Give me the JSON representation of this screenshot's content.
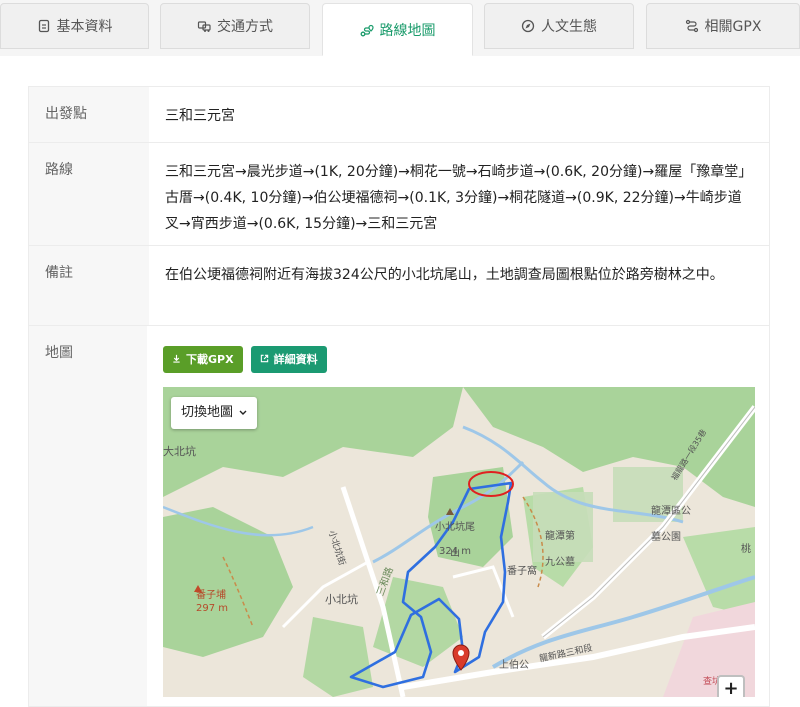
{
  "tabs": [
    {
      "label": "基本資料",
      "icon": "document-icon",
      "active": false
    },
    {
      "label": "交通方式",
      "icon": "car-icon",
      "active": false
    },
    {
      "label": "路線地圖",
      "icon": "route-icon",
      "active": true
    },
    {
      "label": "人文生態",
      "icon": "compass-icon",
      "active": false
    },
    {
      "label": "相關GPX",
      "icon": "path-icon",
      "active": false
    }
  ],
  "details": {
    "start_label": "出發點",
    "start_value": "三和三元宮",
    "route_label": "路線",
    "route_value": "三和三元宮→晨光步道→(1K, 20分鐘)→桐花一號→石崎步道→(0.6K, 20分鐘)→羅屋「豫章堂」古厝→(0.4K, 10分鐘)→伯公埂福德祠→(0.1K, 3分鐘)→桐花隧道→(0.9K, 22分鐘)→牛崎步道叉→宵西步道→(0.6K, 15分鐘)→三和三元宮",
    "note_label": "備註",
    "note_value": "在伯公埂福德祠附近有海拔324公尺的小北坑尾山，土地調查局圖根點位於路旁樹林之中。",
    "map_label": "地圖"
  },
  "buttons": {
    "download_gpx": "下載GPX",
    "details": "詳細資料"
  },
  "map": {
    "switch_label": "切換地圖",
    "zoom_in": "+",
    "labels": {
      "dabeikeng": "大北坑",
      "xiaobeikeng_road": "小北坑街",
      "peak_name": "小北坑尾山",
      "peak_elev": "324 m",
      "longtan_cemetery": "龍潭區公墓公園",
      "longtan_9": "龍潭第九公墓",
      "sanhe_road_3": "三和路",
      "fanzipu": "番子埔",
      "fanzipu_elev": "297 m",
      "xiaobeikeng": "小北坑",
      "lane": "番子窩",
      "shangbogong": "上伯公",
      "longxin_rd": "龍新路三和段",
      "zhakeng": "查坑尾",
      "hwy3": "福龍路一段35巷",
      "tongxing": "桃"
    }
  }
}
